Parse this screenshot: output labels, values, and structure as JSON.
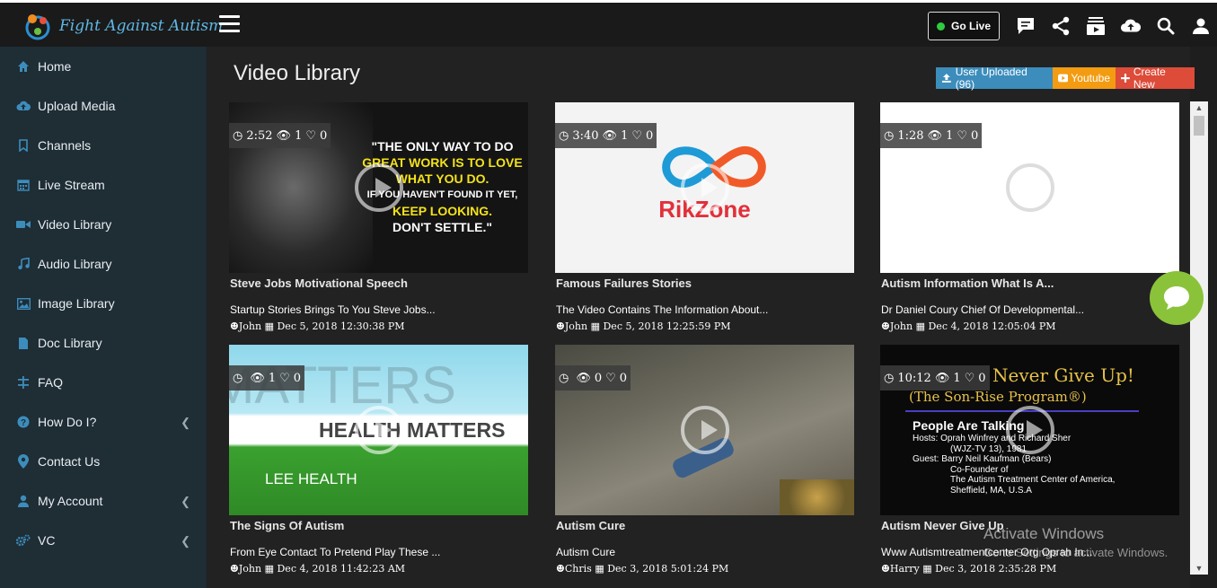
{
  "brand": {
    "name": "Fight Against Autism"
  },
  "topbar": {
    "go_live_label": "Go Live",
    "icons": [
      "chat-icon",
      "share-icon",
      "playlist-icon",
      "cloud-upload-icon",
      "search-icon",
      "user-icon"
    ]
  },
  "sidebar": {
    "items": [
      {
        "label": "Home",
        "icon": "home-icon"
      },
      {
        "label": "Upload Media",
        "icon": "cloud-upload-icon"
      },
      {
        "label": "Channels",
        "icon": "bookmark-icon"
      },
      {
        "label": "Live Stream",
        "icon": "calendar-icon"
      },
      {
        "label": "Video Library",
        "icon": "video-camera-icon"
      },
      {
        "label": "Audio Library",
        "icon": "music-icon"
      },
      {
        "label": "Image Library",
        "icon": "image-icon"
      },
      {
        "label": "Doc Library",
        "icon": "document-icon"
      },
      {
        "label": "FAQ",
        "icon": "faq-icon"
      },
      {
        "label": "How Do I?",
        "icon": "question-icon"
      },
      {
        "label": "Contact Us",
        "icon": "map-marker-icon"
      },
      {
        "label": "My Account",
        "icon": "user-icon"
      },
      {
        "label": "VC",
        "icon": "gears-icon"
      }
    ]
  },
  "main": {
    "title": "Video Library",
    "buttons": {
      "uploaded": "User Uploaded (96)",
      "youtube": "Youtube",
      "create": "Create New"
    },
    "videos": [
      {
        "title": "Steve Jobs Motivational Speech",
        "desc": "Startup Stories Brings To You Steve Jobs...",
        "author": "John",
        "date": "Dec 5, 2018 12:30:38 PM",
        "duration": "2:52",
        "views": "1",
        "likes": "0",
        "thumb_text": [
          "\"THE ONLY WAY TO DO",
          "GREAT WORK IS TO LOVE",
          "WHAT YOU DO.",
          "IF YOU HAVEN'T FOUND IT YET,",
          "KEEP LOOKING.",
          "DON'T SETTLE.\""
        ]
      },
      {
        "title": "Famous Failures Stories",
        "desc": "The Video Contains The Information About...",
        "author": "John",
        "date": "Dec 5, 2018 12:25:59 PM",
        "duration": "3:40",
        "views": "1",
        "likes": "0",
        "thumb_text": [
          "RikZone"
        ]
      },
      {
        "title": "Autism Information What Is A...",
        "desc": "Dr Daniel Coury Chief Of Developmental...",
        "author": "John",
        "date": "Dec 4, 2018 12:05:04 PM",
        "duration": "1:28",
        "views": "1",
        "likes": "0",
        "thumb_text": []
      },
      {
        "title": "The Signs Of Autism",
        "desc": "From Eye Contact To Pretend Play These ...",
        "author": "John",
        "date": "Dec 4, 2018 11:42:23 AM",
        "duration": "",
        "views": "1",
        "likes": "0",
        "thumb_text": [
          "MATTERS",
          "HEALTH MATTERS",
          "LEE HEALTH"
        ]
      },
      {
        "title": "Autism Cure",
        "desc": "Autism Cure",
        "author": "Chris",
        "date": "Dec 3, 2018 5:01:24 PM",
        "duration": "",
        "views": "0",
        "likes": "0",
        "thumb_text": []
      },
      {
        "title": "Autism Never Give Up",
        "desc": "Www Autismtreatmentcenter Org Oprah In...",
        "author": "Harry",
        "date": "Dec 3, 2018 2:35:28 PM",
        "duration": "10:12",
        "views": "1",
        "likes": "0",
        "thumb_text": [
          "Never Give Up!",
          "(The Son-Rise Program®)",
          "People Are Talking",
          "Hosts:  Oprah Winfrey and Richard Sher",
          "(WJZ-TV 13), 1981",
          "Guest:  Barry Neil Kaufman (Bears)",
          "Co-Founder of",
          "The Autism Treatment Center of America,",
          "Sheffield, MA, U.S.A"
        ]
      }
    ]
  },
  "watermark": {
    "line1": "Activate Windows",
    "line2": "Go to Settings to activate Windows."
  },
  "colors": {
    "sidebar_bg": "#1f2d35",
    "accent_blue": "#3c8dbc",
    "youtube_orange": "#f39c12",
    "create_red": "#dd4b39",
    "chat_green": "#8ac33a",
    "live_green": "#2ecc40"
  }
}
